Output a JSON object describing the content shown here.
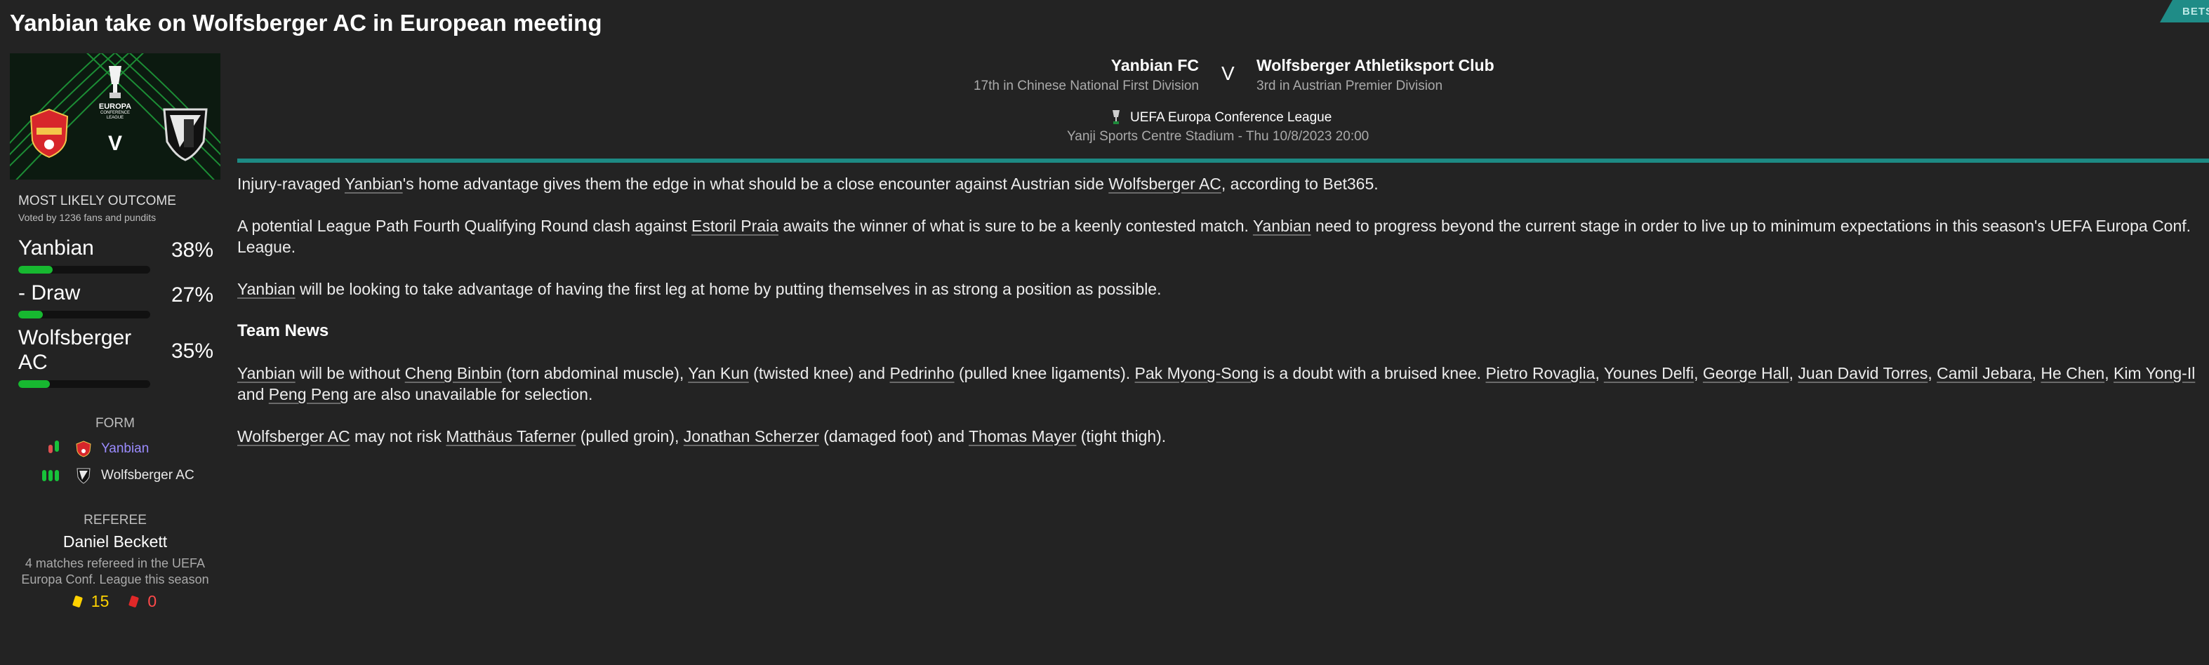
{
  "page": {
    "title": "Yanbian take on Wolfsberger AC in European meeting",
    "corner_tag": "BETS"
  },
  "banner": {
    "v": "V",
    "competition_lines": [
      "EUROPA",
      "CONFERENCE",
      "LEAGUE"
    ]
  },
  "outcome": {
    "title": "MOST LIKELY OUTCOME",
    "voted": "Voted by 1236 fans and pundits",
    "rows": [
      {
        "label": "Yanbian",
        "pct": "38%",
        "fraction": 0.38
      },
      {
        "label": "- Draw",
        "pct": "27%",
        "fraction": 0.27
      },
      {
        "label": "Wolfsberger AC",
        "pct": "35%",
        "fraction": 0.35
      }
    ],
    "bar_color": "#17b830"
  },
  "form": {
    "title": "FORM",
    "teams": [
      {
        "name": "Yanbian",
        "marks": [
          "loss",
          "win"
        ],
        "crest": "yanbian-crest-icon"
      },
      {
        "name": "Wolfsberger AC",
        "marks": [
          "win",
          "win",
          "win"
        ],
        "crest": "wolfsberger-crest-icon"
      }
    ]
  },
  "referee": {
    "title": "REFEREE",
    "name": "Daniel Beckett",
    "note": "4 matches refereed in the UEFA Europa Conf. League this season",
    "yellow_cards": "15",
    "red_cards": "0"
  },
  "match": {
    "home_name": "Yanbian FC",
    "home_position": "17th in Chinese National First Division",
    "vs": "V",
    "away_name": "Wolfsberger Athletiksport Club",
    "away_position": "3rd in Austrian Premier Division",
    "competition": "UEFA Europa Conference League",
    "venue": "Yanji Sports Centre Stadium - Thu 10/8/2023 20:00",
    "accent_color": "#1d8a84"
  },
  "article": {
    "p1": {
      "a": "Injury-ravaged ",
      "yanbian": "Yanbian",
      "b": "'s home advantage gives them the edge in what should be a close encounter against Austrian side ",
      "wolfsberger": "Wolfsberger AC",
      "c": ", according to Bet365."
    },
    "p2": {
      "a": "A potential League Path Fourth Qualifying Round clash against ",
      "estoril": "Estoril Praia",
      "b": " awaits the winner of what is sure to be a keenly contested match. ",
      "yanbian": "Yanbian",
      "c": " need to progress beyond the current stage in order to live up to minimum expectations in this season's UEFA Europa Conf. League."
    },
    "p3": {
      "yanbian": "Yanbian",
      "a": " will be looking to take advantage of having the first leg at home by putting themselves in as strong a position as possible."
    },
    "heading": "Team News",
    "p4": {
      "yanbian": "Yanbian",
      "a": " will be without ",
      "cheng": "Cheng Binbin",
      "b": " (torn abdominal muscle), ",
      "yankun": "Yan Kun",
      "c": " (twisted knee) and ",
      "pedrinho": "Pedrinho",
      "d": " (pulled knee ligaments). ",
      "pak": "Pak Myong-Song",
      "e": " is a doubt with a bruised knee. ",
      "rovaglia": "Pietro Rovaglia",
      "s1": ", ",
      "delfi": "Younes Delfi",
      "s2": ", ",
      "hall": "George Hall",
      "s3": ", ",
      "torres": "Juan David Torres",
      "s4": ", ",
      "jebara": "Camil Jebara",
      "s5": ", ",
      "chen": "He Chen",
      "s6": ", ",
      "kim": "Kim Yong-Il",
      "f": " and ",
      "peng": "Peng Peng",
      "g": " are also unavailable for selection."
    },
    "p5": {
      "wolfsberger": "Wolfsberger AC",
      "a": " may not risk ",
      "taferner": "Matthäus Taferner",
      "b": " (pulled groin), ",
      "scherzer": "Jonathan Scherzer",
      "c": " (damaged foot) and ",
      "mayer": "Thomas Mayer",
      "d": " (tight thigh)."
    }
  }
}
